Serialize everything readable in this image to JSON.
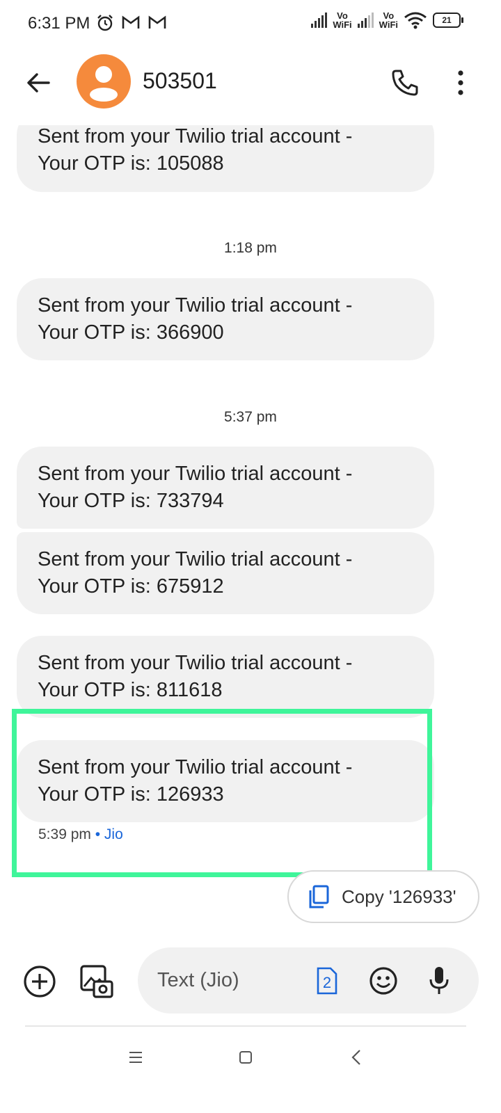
{
  "status_bar": {
    "time": "6:31 PM",
    "notification_icons": [
      "alarm-icon",
      "gmail-icon",
      "gmail-icon"
    ],
    "network_label_top": "Vo",
    "network_label_bottom": "WiFi",
    "battery": "21"
  },
  "header": {
    "contact_name": "503501",
    "accent_color": "#f58a3c"
  },
  "messages": [
    {
      "line1": "Sent from your Twilio trial account -",
      "line2": "Your OTP is: 105088"
    },
    {
      "line1": "Sent from your Twilio trial account -",
      "line2": "Your OTP is: 366900"
    },
    {
      "line1": "Sent from your Twilio trial account -",
      "line2": "Your OTP is: 733794"
    },
    {
      "line1": "Sent from your Twilio trial account -",
      "line2": "Your OTP is: 675912"
    },
    {
      "line1": "Sent from your Twilio trial account -",
      "line2": "Your OTP is: 811618"
    },
    {
      "line1": "Sent from your Twilio trial account -",
      "line2": "Your OTP is: 126933"
    }
  ],
  "time_separators": [
    "1:18 pm",
    "5:37 pm"
  ],
  "last_message_meta": {
    "time": "5:39 pm",
    "separator": " • ",
    "carrier": "Jio"
  },
  "highlight_color": "#3ff59a",
  "copy_chip": {
    "label": "Copy '126933'"
  },
  "compose": {
    "placeholder": "Text (Jio)",
    "sim_number": "2"
  }
}
